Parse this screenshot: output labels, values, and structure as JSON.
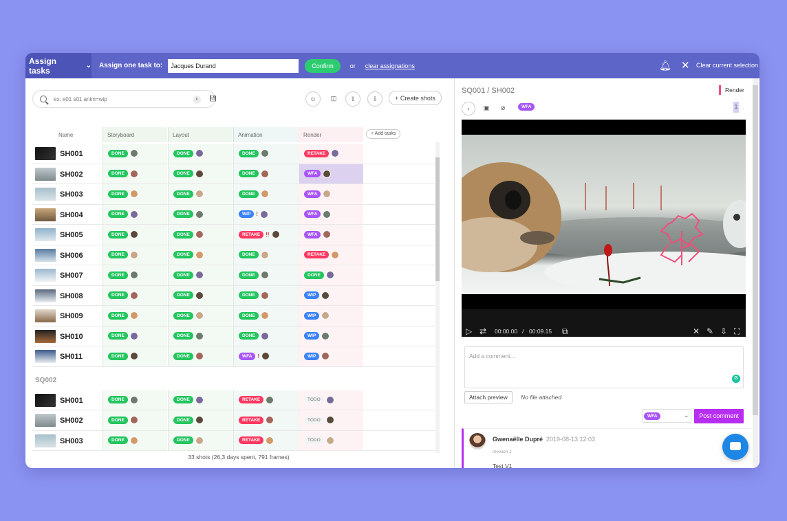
{
  "topbar": {
    "assign_dropdown": "Assign tasks",
    "assign_one_label": "Assign one task to:",
    "assignee": "Jacques Durand",
    "confirm": "Confirm",
    "or": "or",
    "clear_assignations": "clear assignations",
    "clear_selection": "Clear current selection"
  },
  "toolbar": {
    "search_placeholder": "ex: e01 s01 anim=wip",
    "search_clear": "x",
    "create_shots": "+ Create shots"
  },
  "columns": {
    "name": "Name",
    "tasks": [
      "Storyboard",
      "Layout",
      "Animation",
      "Render"
    ],
    "add_tasks": "+ Add tasks"
  },
  "status_colors": {
    "DONE": "#22c55e",
    "WFA": "#a855f7",
    "RETAKE": "#ff3860",
    "WIP": "#3b82f6",
    "TODO": "#f3f3f3"
  },
  "sequences": [
    {
      "name": "SQ001",
      "shots": [
        {
          "name": "SH001",
          "storyboard": "DONE",
          "layout": "DONE",
          "animation": "DONE",
          "animation_extra": "",
          "render": "RETAKE"
        },
        {
          "name": "SH002",
          "storyboard": "DONE",
          "layout": "DONE",
          "animation": "DONE",
          "animation_extra": "",
          "render": "WFA"
        },
        {
          "name": "SH003",
          "storyboard": "DONE",
          "layout": "DONE",
          "animation": "DONE",
          "animation_extra": "",
          "render": "WFA"
        },
        {
          "name": "SH004",
          "storyboard": "DONE",
          "layout": "DONE",
          "animation": "WIP",
          "animation_extra": "!",
          "render": "WFA"
        },
        {
          "name": "SH005",
          "storyboard": "DONE",
          "layout": "DONE",
          "animation": "RETAKE",
          "animation_extra": "!!",
          "render": "WFA"
        },
        {
          "name": "SH006",
          "storyboard": "DONE",
          "layout": "DONE",
          "animation": "DONE",
          "animation_extra": "",
          "render": "RETAKE"
        },
        {
          "name": "SH007",
          "storyboard": "DONE",
          "layout": "DONE",
          "animation": "DONE",
          "animation_extra": "",
          "render": "DONE"
        },
        {
          "name": "SH008",
          "storyboard": "DONE",
          "layout": "DONE",
          "animation": "DONE",
          "animation_extra": "",
          "render": "WIP"
        },
        {
          "name": "SH009",
          "storyboard": "DONE",
          "layout": "DONE",
          "animation": "DONE",
          "animation_extra": "",
          "render": "WIP"
        },
        {
          "name": "SH010",
          "storyboard": "DONE",
          "layout": "DONE",
          "animation": "DONE",
          "animation_extra": "",
          "render": "WIP"
        },
        {
          "name": "SH011",
          "storyboard": "DONE",
          "layout": "DONE",
          "animation": "WFA",
          "animation_extra": "!",
          "render": "WIP"
        }
      ]
    },
    {
      "name": "SQ002",
      "shots": [
        {
          "name": "SH001",
          "storyboard": "DONE",
          "layout": "DONE",
          "animation": "RETAKE",
          "animation_extra": "",
          "render": "TODO"
        },
        {
          "name": "SH002",
          "storyboard": "DONE",
          "layout": "DONE",
          "animation": "RETAKE",
          "animation_extra": "",
          "render": "TODO"
        },
        {
          "name": "SH003",
          "storyboard": "DONE",
          "layout": "DONE",
          "animation": "RETAKE",
          "animation_extra": "",
          "render": "TODO"
        }
      ]
    }
  ],
  "summary": "33 shots (26,3 days spent, 791 frames)",
  "preview": {
    "title": "SQ001 / SH002",
    "task_type": "Render",
    "status": "WFA",
    "page": "1",
    "page_more": "...",
    "time_current": "00:00.00",
    "time_separator": "/",
    "time_total": "00:09.15",
    "progress": 0
  },
  "comment_form": {
    "placeholder": "Add a comment...",
    "attach": "Attach preview",
    "no_file": "No file attached",
    "status": "WFA",
    "post": "Post comment"
  },
  "comment": {
    "author": "Gwenaëlle Dupré",
    "date": "2019-08-13 12:03",
    "revision": "revision 1",
    "text": "Test V1"
  }
}
